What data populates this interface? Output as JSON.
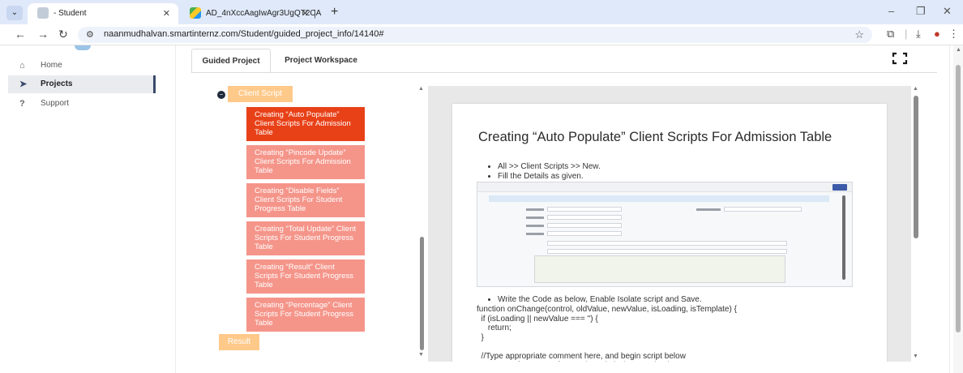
{
  "browser": {
    "tabs": [
      {
        "label": "- Student",
        "active": true
      },
      {
        "label": "AD_4nXccAagIwAgr3UgQT2CA",
        "active": false
      }
    ],
    "new_tab": "+",
    "url": "naanmudhalvan.smartinternz.com/Student/guided_project_info/14140#",
    "window_controls": {
      "minimize": "–",
      "restore": "❐",
      "close": "✕"
    }
  },
  "sidebar": {
    "items": [
      {
        "label": "Home",
        "icon": "home-icon",
        "active": false
      },
      {
        "label": "Projects",
        "icon": "send-icon",
        "active": true
      },
      {
        "label": "Support",
        "icon": "question-icon",
        "active": false
      }
    ]
  },
  "page_tabs": [
    {
      "label": "Guided Project",
      "active": true
    },
    {
      "label": "Project Workspace",
      "active": false
    }
  ],
  "tree": {
    "root": "Client Script",
    "items": [
      {
        "label": "Creating “Auto Populate” Client Scripts For Admission Table",
        "active": true
      },
      {
        "label": "Creating “Pincode Update” Client Scripts For Admission Table",
        "active": false
      },
      {
        "label": "Creating “Disable Fields” Client Scripts For Student Progress Table",
        "active": false
      },
      {
        "label": "Creating “Total Update” Client Scripts For Student Progress Table",
        "active": false
      },
      {
        "label": "Creating “Result” Client Scripts For Student Progress Table",
        "active": false
      },
      {
        "label": "Creating “Percentage” Client Scripts For Student Progress Table",
        "active": false
      }
    ],
    "result": "Result"
  },
  "document": {
    "title": "Creating “Auto Populate” Client Scripts For Admission Table",
    "bullets": [
      "All >> Client Scripts >> New.",
      "Fill the Details as given."
    ],
    "bullet_after": "Write the Code as below, Enable Isolate script and Save.",
    "code": "function onChange(control, oldValue, newValue, isLoading, isTemplate) {\n  if (isLoading || newValue === '') {\n     return;\n  }\n\n  //Type appropriate comment here, and begin script below\n  var a = g_form.getReference('u_admission_number');"
  },
  "colors": {
    "active_item": "#e84118",
    "inactive_item": "#f5958a",
    "root_item": "#ffc98a",
    "sidebar_active_accent": "#3a4a6b"
  }
}
